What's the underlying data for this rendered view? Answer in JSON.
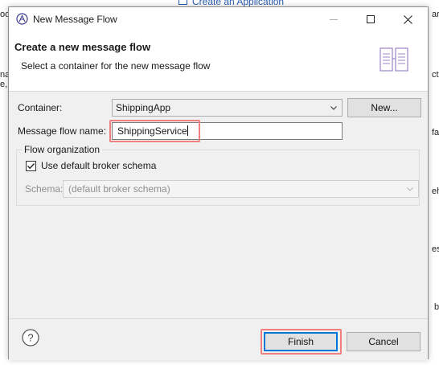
{
  "background": {
    "top_link": "Create an Application",
    "fragments_left": [
      "oo",
      "na",
      "e,"
    ],
    "fragments_right": [
      "ar",
      "ct",
      "fa",
      "eh",
      "est",
      "b"
    ]
  },
  "dialog": {
    "title": "New Message Flow",
    "app_icon": "eclipse-app-icon",
    "header": {
      "title": "Create a new message flow",
      "description": "Select a container for the new message flow",
      "graphic": "message-flow-wizard-icon"
    },
    "container": {
      "label": "Container:",
      "value": "ShippingApp",
      "new_button": "New..."
    },
    "flow_name": {
      "label": "Message flow name:",
      "value": "ShippingService"
    },
    "flow_organization": {
      "title": "Flow organization",
      "checkbox_label": "Use default broker schema",
      "checked": true,
      "schema_label": "Schema:",
      "schema_value": "(default broker schema)"
    },
    "footer": {
      "finish": "Finish",
      "cancel": "Cancel"
    },
    "colors": {
      "highlight": "#f08080",
      "accent": "#0078d7"
    }
  }
}
